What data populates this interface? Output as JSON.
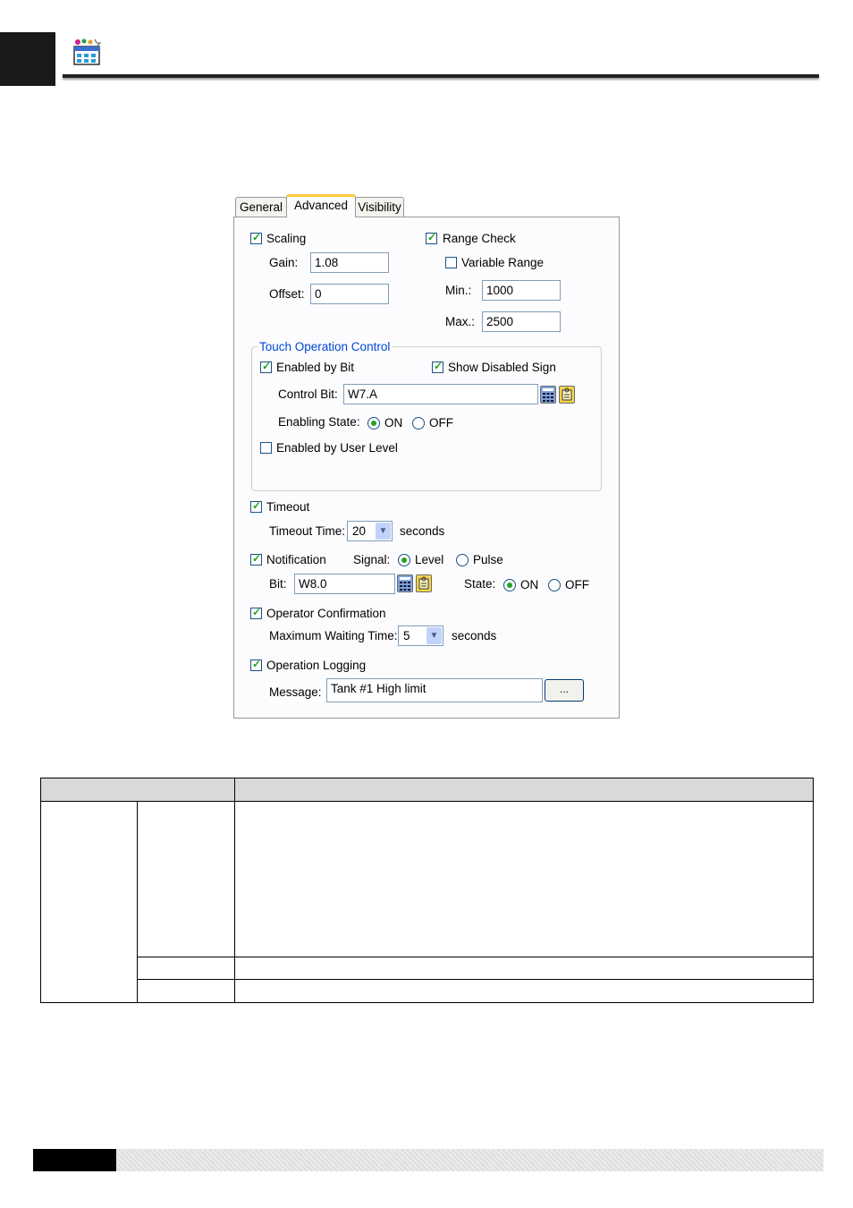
{
  "header": {
    "icon": "table-grid-icon"
  },
  "dialog": {
    "tabs": [
      "General",
      "Advanced",
      "Visibility"
    ],
    "active_tab": "Advanced",
    "scaling": {
      "label": "Scaling",
      "checked": true,
      "gain_label": "Gain:",
      "gain_value": "1.08",
      "offset_label": "Offset:",
      "offset_value": "0"
    },
    "range_check": {
      "label": "Range Check",
      "checked": true,
      "variable_range_label": "Variable Range",
      "variable_range_checked": false,
      "min_label": "Min.:",
      "min_value": "1000",
      "max_label": "Max.:",
      "max_value": "2500"
    },
    "touch_control": {
      "title": "Touch Operation Control",
      "enabled_by_bit_label": "Enabled by Bit",
      "enabled_by_bit_checked": true,
      "show_disabled_label": "Show Disabled Sign",
      "show_disabled_checked": true,
      "control_bit_label": "Control Bit:",
      "control_bit_value": "W7.A",
      "enabling_state_label": "Enabling State:",
      "on_label": "ON",
      "off_label": "OFF",
      "enabling_state_selected": "ON",
      "enabled_by_user_level_label": "Enabled by User Level",
      "enabled_by_user_level_checked": false
    },
    "timeout": {
      "label": "Timeout",
      "checked": true,
      "time_label": "Timeout Time:",
      "time_value": "20",
      "unit": "seconds"
    },
    "notification": {
      "label": "Notification",
      "checked": true,
      "signal_label": "Signal:",
      "level_label": "Level",
      "pulse_label": "Pulse",
      "signal_selected": "Level",
      "bit_label": "Bit:",
      "bit_value": "W8.0",
      "state_label": "State:",
      "on_label": "ON",
      "off_label": "OFF",
      "state_selected": "ON"
    },
    "operator_confirmation": {
      "label": "Operator Confirmation",
      "checked": true,
      "wait_label": "Maximum Waiting Time:",
      "wait_value": "5",
      "unit": "seconds"
    },
    "operation_logging": {
      "label": "Operation Logging",
      "checked": true,
      "message_label": "Message:",
      "message_value": "Tank #1 High limit",
      "browse_label": "..."
    }
  },
  "icons": {
    "calculator": "calculator-icon",
    "tag": "tag-icon",
    "dropdown": "chevron-down-icon"
  }
}
